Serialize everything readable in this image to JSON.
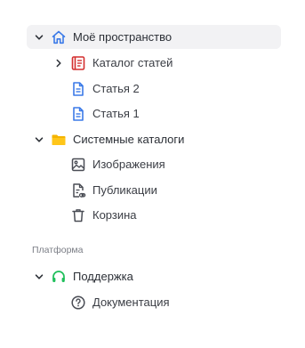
{
  "tree": {
    "my_space": {
      "label": "Моё пространство",
      "icon": "home-icon",
      "expanded": true,
      "selected": true
    },
    "catalog_articles": {
      "label": "Каталог статей",
      "icon": "book-icon",
      "expanded": false
    },
    "article_2": {
      "label": "Статья 2",
      "icon": "document-icon"
    },
    "article_1": {
      "label": "Статья 1",
      "icon": "document-icon"
    },
    "system_catalogs": {
      "label": "Системные каталоги",
      "icon": "folder-icon",
      "expanded": true
    },
    "images": {
      "label": "Изображения",
      "icon": "image-icon"
    },
    "publications": {
      "label": "Публикации",
      "icon": "publication-icon"
    },
    "trash": {
      "label": "Корзина",
      "icon": "trash-icon"
    }
  },
  "platform": {
    "section_label": "Платформа",
    "support": {
      "label": "Поддержка",
      "icon": "headphones-icon",
      "expanded": true
    },
    "documentation": {
      "label": "Документация",
      "icon": "help-circle-icon"
    }
  },
  "colors": {
    "home": "#3b7ae8",
    "book": "#d32f2f",
    "document": "#3b7ae8",
    "folder": "#f5b400",
    "headphones": "#1fbf5b",
    "muted_icon": "#4a4d55",
    "selected_bg": "#f2f2f4"
  }
}
